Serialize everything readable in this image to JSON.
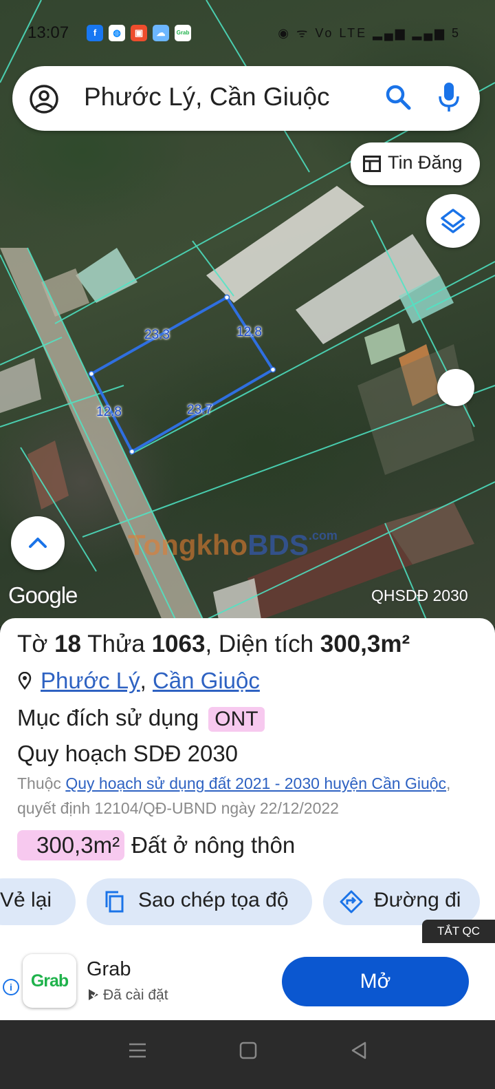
{
  "status_bar": {
    "time": "13:07",
    "right_icons": "◉ ᯤ Vo LTE ▂▄▆ ▂▄▆ 5"
  },
  "search": {
    "query": "Phước Lý, Cần Giuộc"
  },
  "tin_dang": {
    "label": "Tin Đăng"
  },
  "map": {
    "edge_labels": [
      "23.3",
      "12.8",
      "12.8",
      "23.7"
    ],
    "google_logo": "Google",
    "layer_name": "QHSDĐ 2030",
    "watermark_a": "Tongkho",
    "watermark_b": "BDS",
    "watermark_c": ".com"
  },
  "parcel": {
    "to_label": "Tờ",
    "to_value": "18",
    "thua_label": "Thửa",
    "thua_value": "1063",
    "dien_tich_label": ", Diện tích",
    "dien_tich_value": "300,3m²",
    "location_1": "Phước Lý",
    "location_sep": ", ",
    "location_2": "Cần Giuộc",
    "purpose_label": "Mục đích sử dụng",
    "purpose_code": "ONT",
    "plan_title": "Quy hoạch SDĐ 2030",
    "belongs_prefix": "Thuộc",
    "plan_link": "Quy hoạch sử dụng đất 2021 - 2030 huyện Cần Giuộc",
    "decision_text": ", quyết định 12104/QĐ-UBND ngày 22/12/2022",
    "area_value": "300,3m²",
    "area_type": "Đất ở nông thôn"
  },
  "actions": {
    "redraw": "Vẻ lại",
    "copy_coords": "Sao chép tọa độ",
    "directions": "Đường đi"
  },
  "ad": {
    "close_ads": "TẮT QC",
    "app_icon_text": "Grab",
    "app_name": "Grab",
    "installed": "Đã cài đặt",
    "open_button": "Mở",
    "info": "i"
  },
  "colors": {
    "accent_blue": "#0b57d0",
    "chip_bg": "#dde8f8",
    "badge_pink": "#f7c9ef",
    "parcel_line": "#2f6fe0",
    "cadastral": "#4ee6c6"
  }
}
